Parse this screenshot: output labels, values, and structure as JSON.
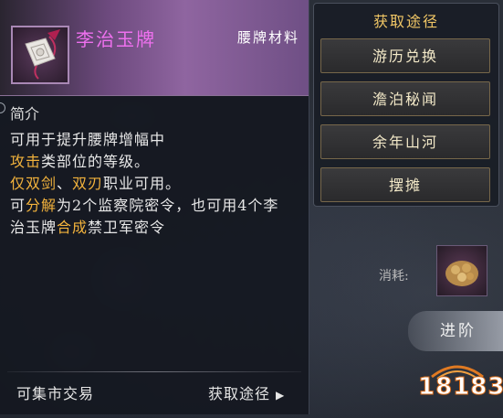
{
  "item": {
    "name": "李治玉牌",
    "type": "腰牌材料",
    "desc_title": "简介",
    "desc_line1": "可用于提升腰牌增幅中",
    "desc_line2_hl": "攻击",
    "desc_line2_rest": "类部位的等级。",
    "desc_line3_hl1": "仅双剑",
    "desc_line3_sep": "、",
    "desc_line3_hl2": "双刃",
    "desc_line3_rest": "职业可用。",
    "desc_line4_a": "可",
    "desc_line4_hl": "分解",
    "desc_line4_b": "为2个监察院密令，也可用4个李",
    "desc_line5_a": "治玉牌",
    "desc_line5_hl": "合成",
    "desc_line5_b": "禁卫军密令",
    "trade_label": "可集市交易",
    "obtain_link": "获取途径"
  },
  "obtain": {
    "title": "获取途径",
    "sources": [
      "游历兑换",
      "澹泊秘闻",
      "余年山河",
      "摆摊"
    ]
  },
  "consume_label": "消耗:",
  "advance_button": "进阶",
  "watermark": "18183",
  "colors": {
    "item_name": "#ee70ee",
    "highlight": "#f2b23c",
    "obtain_title": "#f1c766",
    "header_purple": "#8f65a0"
  },
  "icons": {
    "item_icon": "jade-token-icon",
    "link_arrow": "chevron-right-icon"
  }
}
